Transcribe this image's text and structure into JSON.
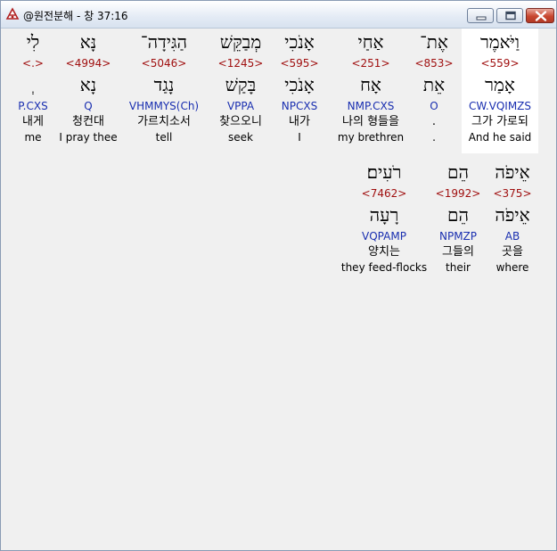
{
  "window": {
    "title": "@원전분해 - 창 37:16"
  },
  "verse_lines": [
    {
      "words": [
        {
          "hebrew": "וַיֹּאמֶר",
          "strong": "<559>",
          "lemma": "אָמַר",
          "morph": "CW.VQIMZS",
          "korean": "그가 가로되",
          "english": "And he said",
          "highlight": true
        },
        {
          "hebrew": "אֶת־",
          "strong": "<853>",
          "lemma": "אֵת",
          "morph": "O",
          "korean": ".",
          "english": "."
        },
        {
          "hebrew": "אַחַי",
          "strong": "<251>",
          "lemma": "אָח",
          "morph": "NMP.CXS",
          "korean": "나의 형들을",
          "english": "my brethren"
        },
        {
          "hebrew": "אָנֹכִי",
          "strong": "<595>",
          "lemma": "אָנֹכִי",
          "morph": "NPCXS",
          "korean": "내가",
          "english": "I"
        },
        {
          "hebrew": "מְבַקֵּשׁ",
          "strong": "<1245>",
          "lemma": "בָּקַשׁ",
          "morph": "VPPA",
          "korean": "찾으오니",
          "english": "seek"
        },
        {
          "hebrew": "הַגִּידָה־",
          "strong": "<5046>",
          "lemma": "נָגַד",
          "morph": "VHMMYS(Ch)",
          "korean": "가르치소서",
          "english": "tell"
        },
        {
          "hebrew": "נָּא",
          "strong": "<4994>",
          "lemma": "נָא",
          "morph": "Q",
          "korean": "청컨대",
          "english": "I pray thee"
        },
        {
          "hebrew": "לִי",
          "strong": "<.>",
          "lemma": "ְ",
          "morph": "P.CXS",
          "korean": "내게",
          "english": "me"
        }
      ]
    },
    {
      "words": [
        {
          "hebrew": "אֵיפֹה",
          "strong": "<375>",
          "lemma": "אֵיפֹה",
          "morph": "AB",
          "korean": "곳을",
          "english": "where"
        },
        {
          "hebrew": "הֵם",
          "strong": "<1992>",
          "lemma": "הֵם",
          "morph": "NPMZP",
          "korean": "그들의",
          "english": "their"
        },
        {
          "hebrew": "רֹעִים׃",
          "strong": "<7462>",
          "lemma": "רָעָה",
          "morph": "VQPAMP",
          "korean": "양치는",
          "english": "they feed-flocks"
        }
      ]
    }
  ]
}
